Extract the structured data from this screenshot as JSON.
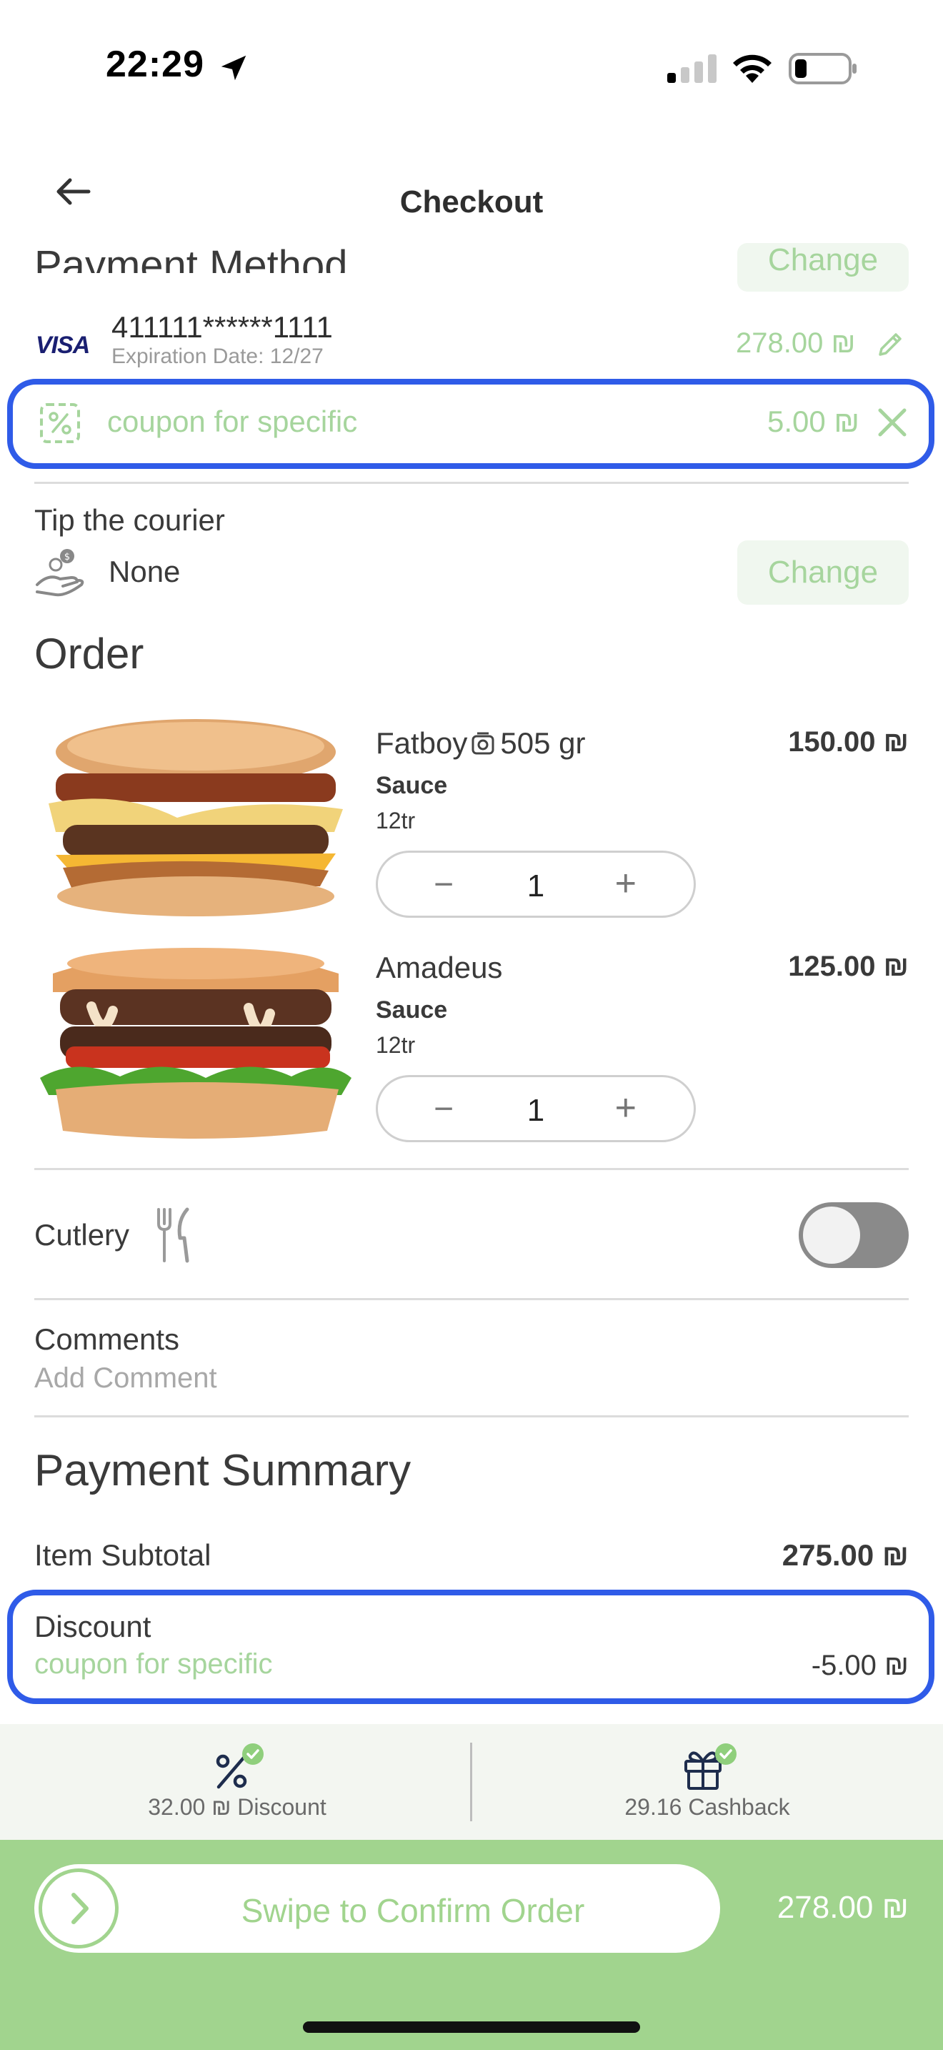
{
  "status_bar": {
    "time": "22:29"
  },
  "header": {
    "title": "Checkout"
  },
  "payment_method": {
    "title": "Payment Method",
    "change_label": "Change",
    "card_brand": "VISA",
    "card_number": "411111******1111",
    "expiration": "Expiration Date: 12/27",
    "amount": "278.00 ₪"
  },
  "coupon": {
    "label": "coupon for specific",
    "amount": "5.00 ₪"
  },
  "tip": {
    "label": "Tip the courier",
    "value": "None",
    "change_label": "Change"
  },
  "order": {
    "title": "Order",
    "items": [
      {
        "name": "Fatboy",
        "weight": "505 gr",
        "option_title": "Sauce",
        "option_value": "12tr",
        "quantity": "1",
        "price": "150.00 ₪"
      },
      {
        "name": "Amadeus",
        "option_title": "Sauce",
        "option_value": "12tr",
        "quantity": "1",
        "price": "125.00 ₪"
      }
    ]
  },
  "cutlery": {
    "label": "Cutlery",
    "enabled": false
  },
  "comments": {
    "label": "Comments",
    "placeholder": "Add Comment"
  },
  "summary": {
    "title": "Payment Summary",
    "subtotal_label": "Item Subtotal",
    "subtotal_amount": "275.00 ₪",
    "discount_label": "Discount",
    "discount_coupon": "coupon for specific",
    "discount_amount": "-5.00 ₪"
  },
  "benefits": {
    "discount": "32.00 ₪ Discount",
    "cashback": "29.16 Cashback"
  },
  "footer": {
    "swipe_label": "Swipe to Confirm Order",
    "total": "278.00 ₪"
  },
  "colors": {
    "accent_green": "#a1d48e",
    "highlight_blue": "#2f5be8",
    "visa_blue": "#1a1f71"
  }
}
